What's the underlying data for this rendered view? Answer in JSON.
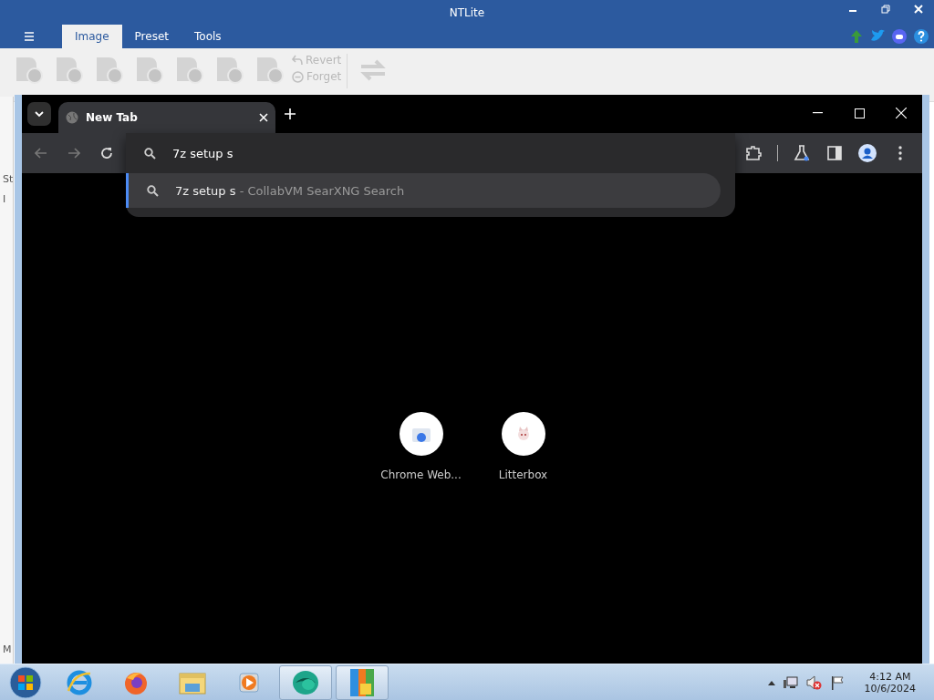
{
  "ntlite": {
    "title": "NTLite",
    "tabs": [
      {
        "label": "Image",
        "selected": true
      },
      {
        "label": "Preset",
        "selected": false
      },
      {
        "label": "Tools",
        "selected": false
      }
    ],
    "toolbar": [
      {
        "disabled": true
      },
      {
        "disabled": true
      },
      {
        "disabled": true
      },
      {
        "disabled": true
      },
      {
        "disabled": true
      },
      {
        "disabled": true
      },
      {
        "disabled": true
      }
    ],
    "small_buttons": [
      {
        "label": "Revert",
        "disabled": true
      },
      {
        "label": "Forget",
        "disabled": true
      }
    ],
    "refresh": {
      "disabled": true
    },
    "side_fragments": [
      "St",
      "I",
      "M"
    ]
  },
  "chrome": {
    "tab": {
      "title": "New Tab"
    },
    "omnibox": {
      "value": "7z setup s"
    },
    "suggestions": [
      {
        "query": "7z setup s",
        "source": "- CollabVM SearXNG Search",
        "selected": true
      }
    ],
    "shortcuts": [
      {
        "label": "Chrome Web..."
      },
      {
        "label": "Litterbox"
      }
    ]
  },
  "taskbar": {
    "apps": [
      {
        "kind": "ie",
        "running": false
      },
      {
        "kind": "firefox",
        "running": false
      },
      {
        "kind": "explorer",
        "running": false
      },
      {
        "kind": "media",
        "running": false
      },
      {
        "kind": "viewer",
        "running": true
      },
      {
        "kind": "ntlite",
        "running": true
      }
    ],
    "time": "4:12 AM",
    "date": "10/6/2024"
  }
}
